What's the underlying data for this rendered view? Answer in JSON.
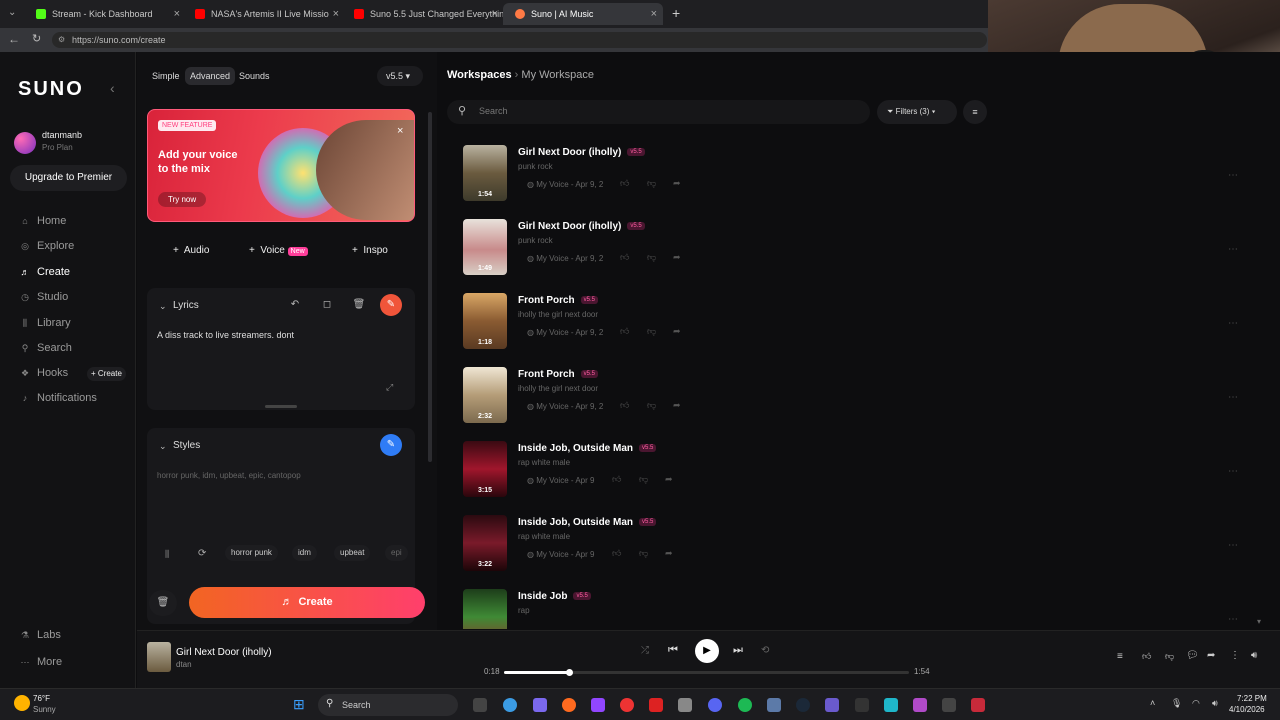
{
  "browser": {
    "tabs": [
      {
        "label": "Stream - Kick Dashboard",
        "color": "#53fc18"
      },
      {
        "label": "NASA's Artemis II Live Missio",
        "color": "#ff0000"
      },
      {
        "label": "Suno 5.5 Just Changed Everything",
        "color": "#ff0000"
      },
      {
        "label": "Suno | AI Music",
        "color": "#ff7a45"
      }
    ],
    "new_tab": "+",
    "url": "https://suno.com/create"
  },
  "sidebar": {
    "logo": "SUNO",
    "collapse_icon": "‹",
    "user": {
      "name": "dtanmanb",
      "plan": "Pro Plan"
    },
    "upgrade_label": "Upgrade to Premier",
    "nav": [
      {
        "label": "Home",
        "icon": "⌂"
      },
      {
        "label": "Explore",
        "icon": "◎"
      },
      {
        "label": "Create",
        "icon": "♬"
      },
      {
        "label": "Studio",
        "icon": "◷"
      },
      {
        "label": "Library",
        "icon": "⫼"
      },
      {
        "label": "Search",
        "icon": "⚲"
      },
      {
        "label": "Hooks",
        "icon": "❖"
      },
      {
        "label": "Notifications",
        "icon": "♪"
      }
    ],
    "hooks_create": "+ Create",
    "labs": "Labs",
    "more": "More"
  },
  "create_panel": {
    "modes": [
      "Simple",
      "Advanced",
      "Sounds"
    ],
    "version": "v5.5",
    "feature": {
      "badge": "NEW FEATURE",
      "title": "Add your voice to the mix",
      "cta": "Try now"
    },
    "add_buttons": [
      {
        "label": "Audio"
      },
      {
        "label": "Voice",
        "badge": "New"
      },
      {
        "label": "Inspo"
      }
    ],
    "lyrics": {
      "heading": "Lyrics",
      "text": "A diss track to live streamers. dont"
    },
    "styles": {
      "heading": "Styles",
      "placeholder": "horror punk, idm, upbeat, epic, cantopop",
      "chips": [
        "horror punk",
        "idm",
        "upbeat",
        "epi"
      ]
    },
    "create_label": "Create"
  },
  "workspace": {
    "breadcrumb": {
      "root": "Workspaces",
      "current": "My Workspace"
    },
    "search_placeholder": "Search",
    "filters_label": "Filters (3)",
    "songs": [
      {
        "title": "Girl Next Door (iholly)",
        "version": "v5.5",
        "style": "punk rock",
        "meta": "My Voice - Apr 9, 2",
        "duration": "1:54"
      },
      {
        "title": "Girl Next Door (iholly)",
        "version": "v5.5",
        "style": "punk rock",
        "meta": "My Voice - Apr 9, 2",
        "duration": "1:49"
      },
      {
        "title": "Front Porch",
        "version": "v5.5",
        "style": "iholly the girl next door",
        "meta": "My Voice - Apr 9, 2",
        "duration": "1:18"
      },
      {
        "title": "Front Porch",
        "version": "v5.5",
        "style": "iholly the girl next door",
        "meta": "My Voice - Apr 9, 2",
        "duration": "2:32"
      },
      {
        "title": "Inside Job, Outside Man",
        "version": "v5.5",
        "style": "rap white male",
        "meta": "My Voice - Apr 9",
        "duration": "3:15"
      },
      {
        "title": "Inside Job, Outside Man",
        "version": "v5.5",
        "style": "rap white male",
        "meta": "My Voice - Apr 9",
        "duration": "3:22"
      },
      {
        "title": "Inside Job",
        "version": "v5.5",
        "style": "rap",
        "meta": "",
        "duration": ""
      }
    ]
  },
  "player": {
    "title": "Girl Next Door (iholly)",
    "artist": "dtan",
    "elapsed": "0:18",
    "total": "1:54",
    "progress": 0.16
  },
  "taskbar": {
    "weather_temp": "76°F",
    "weather_text": "Sunny",
    "search_label": "Search",
    "time": "7:22 PM",
    "date": "4/10/2026"
  }
}
